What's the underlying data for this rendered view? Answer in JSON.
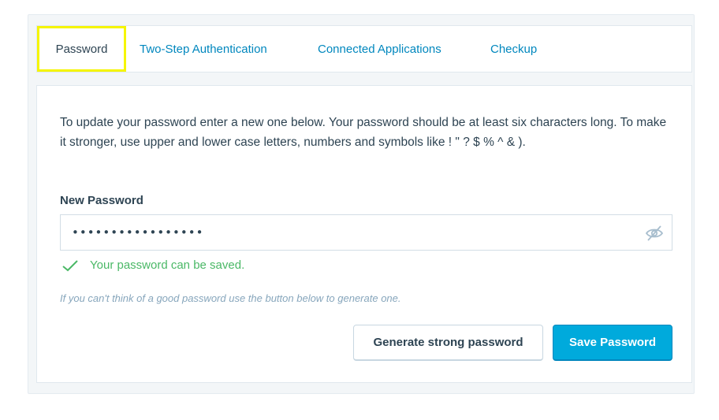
{
  "tabs": [
    {
      "label": "Password",
      "active": true
    },
    {
      "label": "Two-Step Authentication",
      "active": false
    },
    {
      "label": "Connected Applications",
      "active": false
    },
    {
      "label": "Checkup",
      "active": false
    }
  ],
  "form": {
    "intro": "To update your password enter a new one below. Your password should be at least six characters long. To make it stronger, use upper and lower case letters, numbers and symbols like ! \" ? $ % ^ & ).",
    "new_password_label": "New Password",
    "password_value": "•••••••••••••••••",
    "visibility_icon": "eye-hidden-icon",
    "validation_message": "Your password can be saved.",
    "hint": "If you can't think of a good password use the button below to generate one.",
    "generate_label": "Generate strong password",
    "save_label": "Save Password"
  },
  "colors": {
    "accent": "#0087be",
    "primary_button": "#00aadc",
    "success": "#4ab866",
    "highlight": "#f5f500"
  }
}
